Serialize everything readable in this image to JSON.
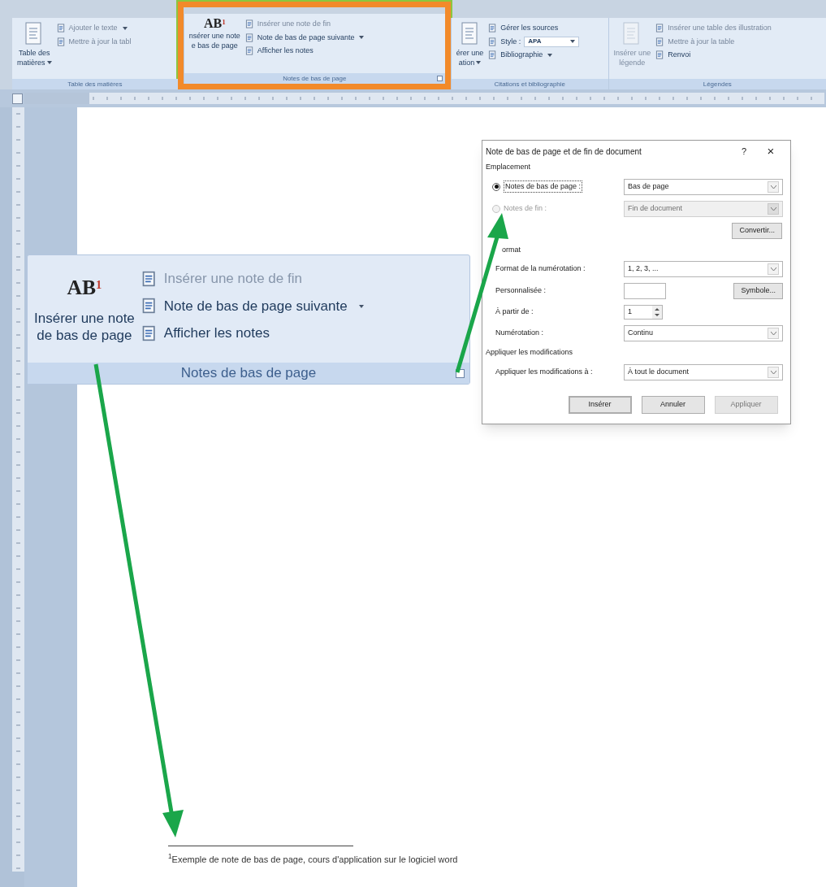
{
  "ribbon": {
    "groups": [
      {
        "label": "Table des matières",
        "highlighted": false,
        "launcher": false,
        "large": {
          "lines": [
            "Table des",
            "matières"
          ],
          "caret": true,
          "disabled": false
        },
        "items": [
          {
            "label": "Ajouter le texte",
            "caret": true,
            "disabled": true
          },
          {
            "label": "Mettre à jour la tabl",
            "caret": false,
            "disabled": true
          }
        ]
      },
      {
        "label": "Notes de bas de page",
        "highlighted": true,
        "launcher": true,
        "large": {
          "icon_text": "AB",
          "icon_sup": "1",
          "lines": [
            "nsérer une note",
            "e bas de page"
          ],
          "caret": false,
          "disabled": false
        },
        "items": [
          {
            "label": "Insérer une note de fin",
            "caret": false,
            "disabled": true
          },
          {
            "label": "Note de bas de page suivante",
            "caret": true,
            "disabled": false
          },
          {
            "label": "Afficher les notes",
            "caret": false,
            "disabled": false
          }
        ]
      },
      {
        "label": "Citations et bibliographie",
        "highlighted": false,
        "launcher": false,
        "large": {
          "lines": [
            "érer une",
            "ation"
          ],
          "caret": true,
          "disabled": false
        },
        "items": [
          {
            "label": "Gérer les sources",
            "caret": false,
            "disabled": false
          },
          {
            "label": "Style :",
            "value": "APA",
            "caret": true,
            "disabled": false
          },
          {
            "label": "Bibliographie",
            "caret": true,
            "disabled": false
          }
        ]
      },
      {
        "label": "Légendes",
        "highlighted": false,
        "launcher": false,
        "large": {
          "lines": [
            "Insérer une",
            "légende"
          ],
          "caret": false,
          "disabled": true
        },
        "items": [
          {
            "label": "Insérer une table des illustration",
            "caret": false,
            "disabled": true
          },
          {
            "label": "Mettre à jour la table",
            "caret": false,
            "disabled": true
          },
          {
            "label": "Renvoi",
            "caret": false,
            "disabled": false
          }
        ]
      }
    ]
  },
  "callout": {
    "label": "Notes de bas de page",
    "launcher": true,
    "large": {
      "icon_text": "AB",
      "icon_sup": "1",
      "lines": [
        "Insérer une note",
        "de bas de page"
      ]
    },
    "items": [
      {
        "label": "Insérer une note de fin",
        "caret": false,
        "disabled": true
      },
      {
        "label": "Note de bas de page suivante",
        "caret": true,
        "disabled": false
      },
      {
        "label": "Afficher les notes",
        "caret": false,
        "disabled": false
      }
    ]
  },
  "dialog": {
    "title": "Note de bas de page et de fin de document",
    "help": "?",
    "close": "×",
    "emplacement": {
      "title": "Emplacement",
      "rows": [
        {
          "label": "Notes de bas de page :",
          "selected": true,
          "disabled": false,
          "value": "Bas de page"
        },
        {
          "label": "Notes de fin :",
          "selected": false,
          "disabled": true,
          "value": "Fin de document"
        }
      ],
      "button": "Convertir..."
    },
    "format": {
      "title": "ormat",
      "rows": [
        {
          "kind": "select",
          "label": "Format de la numérotation :",
          "value": "1, 2, 3, ..."
        },
        {
          "kind": "input",
          "label": "Personnalisée :",
          "button": "Symbole..."
        },
        {
          "kind": "spin",
          "label": "À partir de :",
          "value": "1"
        },
        {
          "kind": "select",
          "label": "Numérotation :",
          "value": "Continu"
        }
      ]
    },
    "apply": {
      "title": "Appliquer les modifications",
      "label": "Appliquer les modifications à :",
      "value": "À tout le document"
    },
    "buttons": [
      {
        "label": "Insérer",
        "default": true,
        "disabled": false
      },
      {
        "label": "Annuler",
        "default": false,
        "disabled": false
      },
      {
        "label": "Appliquer",
        "default": false,
        "disabled": true
      }
    ]
  },
  "footnote": {
    "text": "$^{1}$Exemple de note de bas de page, cours d'application sur le logiciel word"
  }
}
